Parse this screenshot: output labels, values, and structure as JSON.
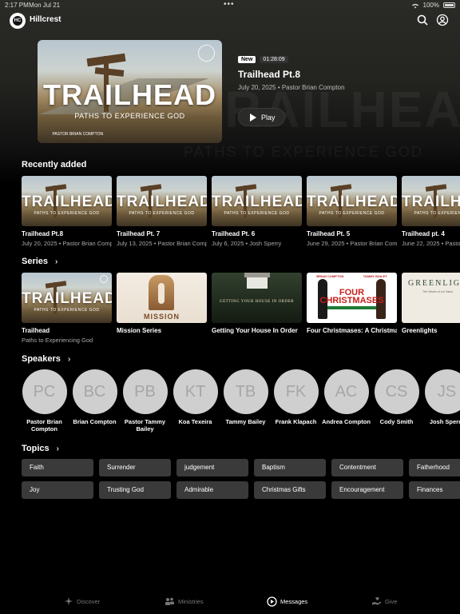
{
  "status_bar": {
    "time": "2:17 PM",
    "date": "Mon Jul 21",
    "battery": "100%"
  },
  "header": {
    "app_name": "Hillcrest",
    "logo_text": "HC"
  },
  "hero_bg": {
    "title": "TRAILHEAD",
    "subtitle": "PATHS TO EXPERIENCE GOD"
  },
  "featured": {
    "art_title": "TRAILHEAD",
    "art_subtitle": "PATHS TO EXPERIENCE GOD",
    "art_pastor": "PASTOR BRIAN COMPTON",
    "badge_new": "New",
    "duration": "01:28:09",
    "title": "Trailhead Pt.8",
    "meta": "July 20, 2025 • Pastor Brian Compton",
    "play_label": "Play"
  },
  "recently_added": {
    "heading": "Recently added",
    "items": [
      {
        "art_title": "TRAILHEAD",
        "art_subtitle": "PATHS TO EXPERIENCE GOD",
        "title": "Trailhead Pt.8",
        "meta": "July 20, 2025 • Pastor Brian Compton"
      },
      {
        "art_title": "TRAILHEAD",
        "art_subtitle": "PATHS TO EXPERIENCE GOD",
        "title": "Trailhead Pt. 7",
        "meta": "July 13, 2025 • Pastor Brian Compton"
      },
      {
        "art_title": "TRAILHEAD",
        "art_subtitle": "PATHS TO EXPERIENCE GOD",
        "title": "Trailhead Pt. 6",
        "meta": "July 6, 2025 • Josh Sperry"
      },
      {
        "art_title": "TRAILHEAD",
        "art_subtitle": "PATHS TO EXPERIENCE GOD",
        "title": "Trailhead Pt. 5",
        "meta": "June 29, 2025 • Pastor Brian Compton"
      },
      {
        "art_title": "TRAILHEAD",
        "art_subtitle": "PATHS TO EXPERIENCE GOD",
        "title": "Trailhead pt. 4",
        "meta": "June 22, 2025 • Pastor Brian Compton"
      }
    ]
  },
  "series": {
    "heading": "Series",
    "items": [
      {
        "title": "Trailhead",
        "subtitle": "Paths to Experiencing God",
        "art_title": "TRAILHEAD",
        "art_subtitle": "PATHS TO EXPERIENCE GOD"
      },
      {
        "title": "Mission Series",
        "art_title": "MISSION"
      },
      {
        "title": "Getting Your House In Order",
        "art_title": "GETTING YOUR HOUSE IN ORDER"
      },
      {
        "title": "Four Christmases: A Christmas Series",
        "art_title_1": "FOUR",
        "art_title_2": "CHRISTMASES",
        "art_left": "BRIAN COMPTON",
        "art_right": "TAMMY BAILEY"
      },
      {
        "title": "Greenlights",
        "art_title": "GREENLIGHTS",
        "art_subtitle": "The Virtues of our Vision"
      }
    ]
  },
  "speakers": {
    "heading": "Speakers",
    "items": [
      {
        "initials": "PC",
        "name": "Pastor Brian Compton"
      },
      {
        "initials": "BC",
        "name": "Brian Compton"
      },
      {
        "initials": "PB",
        "name": "Pastor Tammy Bailey"
      },
      {
        "initials": "KT",
        "name": "Koa Texeira"
      },
      {
        "initials": "TB",
        "name": "Tammy Bailey"
      },
      {
        "initials": "FK",
        "name": "Frank Klapach"
      },
      {
        "initials": "AC",
        "name": "Andrea Compton"
      },
      {
        "initials": "CS",
        "name": "Cody Smith"
      },
      {
        "initials": "JS",
        "name": "Josh Sperry"
      }
    ]
  },
  "topics": {
    "heading": "Topics",
    "items": [
      "Faith",
      "Surrender",
      "judgement",
      "Baptism",
      "Contentment",
      "Fatherhood",
      "Joy",
      "Trusting God",
      "Admirable",
      "Christmas Gifts",
      "Encouragement",
      "Finances"
    ]
  },
  "tabs": [
    {
      "label": "Discover",
      "icon": "sparkle-icon"
    },
    {
      "label": "Ministries",
      "icon": "people-icon"
    },
    {
      "label": "Messages",
      "icon": "play-circle-icon",
      "active": true
    },
    {
      "label": "Give",
      "icon": "give-hand-icon"
    }
  ],
  "colors": {
    "background": "#000000",
    "chip": "#3a3a3a",
    "avatar": "#cfcfcf",
    "active_tab": "#ffffff",
    "inactive_tab": "#777777"
  }
}
